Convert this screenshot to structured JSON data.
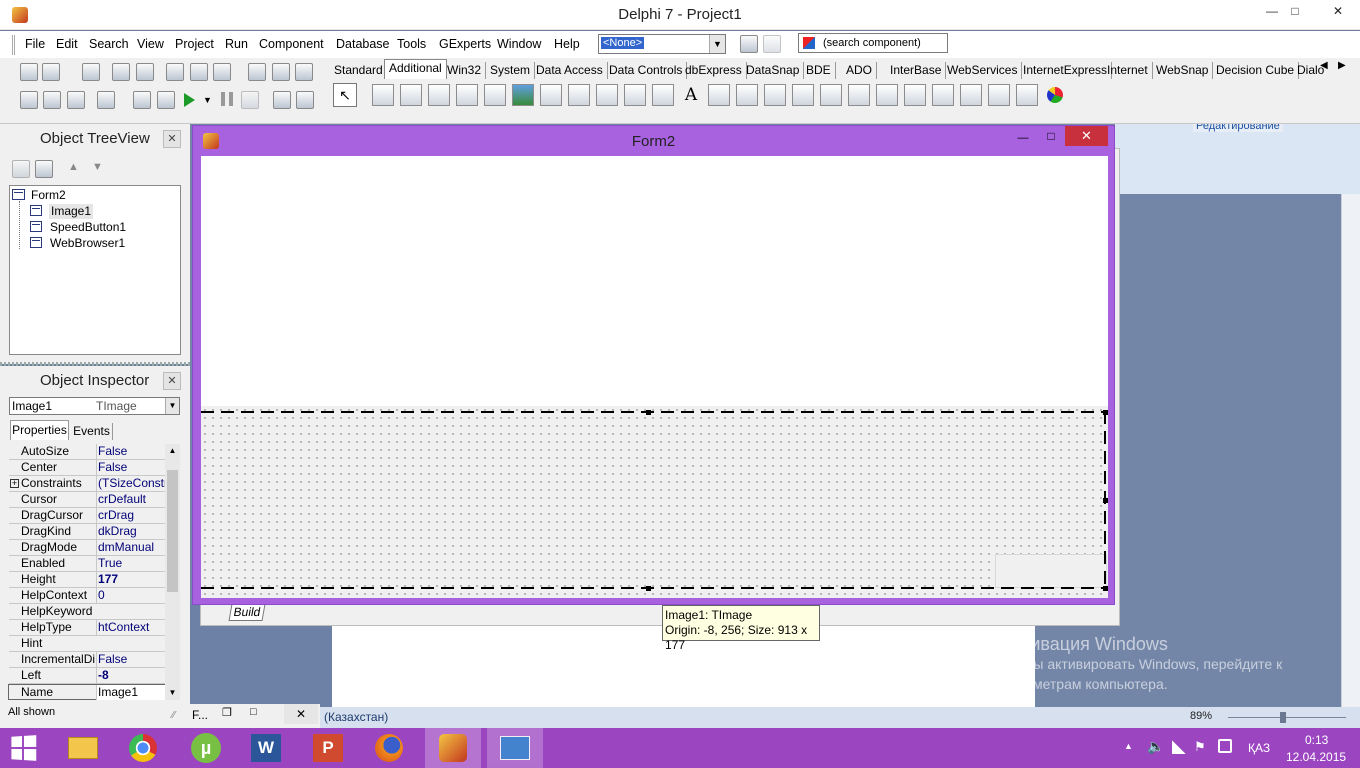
{
  "window": {
    "title": "Delphi 7 - Project1",
    "minimize": "—",
    "maximize": "□",
    "close": "✕"
  },
  "menu": [
    "File",
    "Edit",
    "Search",
    "View",
    "Project",
    "Run",
    "Component",
    "Database",
    "Tools",
    "GExperts",
    "Window",
    "Help"
  ],
  "toolbar": {
    "object_combo": "<None>",
    "search_component": "(search component)"
  },
  "palette_tabs": [
    "Standard",
    "Additional",
    "Win32",
    "System",
    "Data Access",
    "Data Controls",
    "dbExpress",
    "DataSnap",
    "BDE",
    "ADO",
    "InterBase",
    "WebServices",
    "InternetExpress",
    "Internet",
    "WebSnap",
    "Decision Cube",
    "Dialo"
  ],
  "palette_selected": "Additional",
  "treeview": {
    "title": "Object TreeView",
    "close": "✕",
    "root": "Form2",
    "children": [
      "Image1",
      "SpeedButton1",
      "WebBrowser1"
    ]
  },
  "inspector": {
    "title": "Object Inspector",
    "close": "✕",
    "object_name": "Image1",
    "object_type": "TImage",
    "tab_properties": "Properties",
    "tab_events": "Events",
    "rows": [
      {
        "name": "AutoSize",
        "value": "False"
      },
      {
        "name": "Center",
        "value": "False"
      },
      {
        "name": "Constraints",
        "value": "(TSizeConstra"
      },
      {
        "name": "Cursor",
        "value": "crDefault"
      },
      {
        "name": "DragCursor",
        "value": "crDrag"
      },
      {
        "name": "DragKind",
        "value": "dkDrag"
      },
      {
        "name": "DragMode",
        "value": "dmManual"
      },
      {
        "name": "Enabled",
        "value": "True"
      },
      {
        "name": "Height",
        "value": "177"
      },
      {
        "name": "HelpContext",
        "value": "0"
      },
      {
        "name": "HelpKeyword",
        "value": ""
      },
      {
        "name": "HelpType",
        "value": "htContext"
      },
      {
        "name": "Hint",
        "value": ""
      },
      {
        "name": "IncrementalDisp",
        "value": "False"
      },
      {
        "name": "Left",
        "value": "-8"
      },
      {
        "name": "Name",
        "value": "Image1"
      }
    ],
    "status": "All shown"
  },
  "form2": {
    "title": "Form2",
    "minimize": "—",
    "maximize": "□",
    "close": "✕"
  },
  "build_tab": "Build",
  "background_labels": {
    "editing": "Редактирование",
    "kazakh": "(Казахстан)",
    "tab_f": "F..."
  },
  "tooltip": {
    "line1": "Image1: TImage",
    "line2": "Origin: -8, 256; Size: 913 x 177"
  },
  "activation": {
    "title": "Активация Windows",
    "line1": "Чтобы активировать Windows, перейдите к",
    "line2": "параметрам компьютера."
  },
  "zoom": "89%",
  "tray": {
    "lang": "ҚАЗ",
    "time": "0:13",
    "date": "12.04.2015"
  },
  "colors": {
    "taskbar": "#9b46c0",
    "form_frame": "#a862e0",
    "close_red": "#c7303c"
  }
}
